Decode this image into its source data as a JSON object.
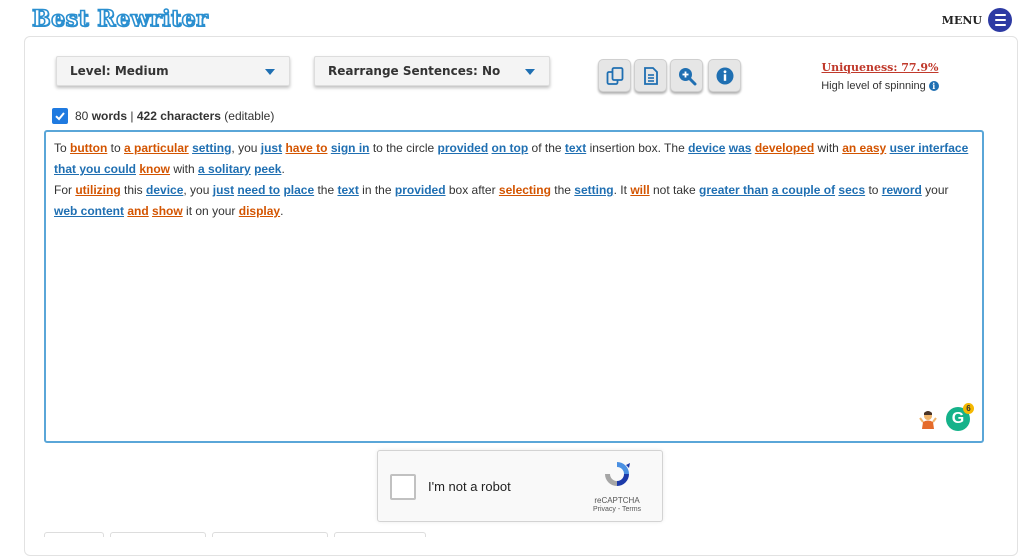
{
  "header": {
    "logo": "Best Rewriter",
    "menu_label": "MENU"
  },
  "controls": {
    "level": "Level: Medium",
    "rearrange": "Rearrange Sentences: No",
    "buttons": [
      "copy-icon",
      "document-icon",
      "zoom-in-icon",
      "info-icon"
    ]
  },
  "uniqueness": {
    "link": "Uniqueness: 77.9%",
    "subtext": "High level of spinning"
  },
  "counter": {
    "words_count": "80",
    "words_label": "words",
    "separator": "|",
    "chars": "422 characters",
    "note": "(editable)"
  },
  "editor": {
    "paragraphs": [
      [
        {
          "t": "To "
        },
        {
          "t": "button",
          "c": "o"
        },
        {
          "t": " to "
        },
        {
          "t": "a particular",
          "c": "o"
        },
        {
          "t": " "
        },
        {
          "t": "setting",
          "c": "b"
        },
        {
          "t": ", you "
        },
        {
          "t": "just",
          "c": "b"
        },
        {
          "t": " "
        },
        {
          "t": "have to",
          "c": "o"
        },
        {
          "t": " "
        },
        {
          "t": "sign in",
          "c": "b"
        },
        {
          "t": " to the circle "
        },
        {
          "t": "provided",
          "c": "b"
        },
        {
          "t": " "
        },
        {
          "t": "on top",
          "c": "b"
        },
        {
          "t": " of the "
        },
        {
          "t": "text",
          "c": "b"
        },
        {
          "t": " insertion box. The "
        },
        {
          "t": "device",
          "c": "b"
        },
        {
          "t": " "
        },
        {
          "t": "was",
          "c": "b"
        },
        {
          "t": " "
        },
        {
          "t": "developed",
          "c": "o"
        },
        {
          "t": " with "
        },
        {
          "t": "an easy",
          "c": "o"
        },
        {
          "t": " "
        },
        {
          "t": "user interface",
          "c": "b"
        },
        {
          "t": " "
        },
        {
          "t": "that you could",
          "c": "b"
        },
        {
          "t": " "
        },
        {
          "t": "know",
          "c": "o"
        },
        {
          "t": " with "
        },
        {
          "t": "a solitary",
          "c": "b"
        },
        {
          "t": " "
        },
        {
          "t": "peek",
          "c": "b"
        },
        {
          "t": "."
        }
      ],
      [
        {
          "t": "For "
        },
        {
          "t": "utilizing",
          "c": "o"
        },
        {
          "t": " this "
        },
        {
          "t": "device",
          "c": "b"
        },
        {
          "t": ", you "
        },
        {
          "t": "just",
          "c": "b"
        },
        {
          "t": " "
        },
        {
          "t": "need to",
          "c": "b"
        },
        {
          "t": " "
        },
        {
          "t": "place",
          "c": "b"
        },
        {
          "t": " the "
        },
        {
          "t": "text",
          "c": "b"
        },
        {
          "t": " in the "
        },
        {
          "t": "provided",
          "c": "b"
        },
        {
          "t": " box after "
        },
        {
          "t": "selecting",
          "c": "o"
        },
        {
          "t": " the "
        },
        {
          "t": "setting",
          "c": "b"
        },
        {
          "t": ". It "
        },
        {
          "t": "will",
          "c": "o"
        },
        {
          "t": " not take "
        },
        {
          "t": "greater than",
          "c": "b"
        },
        {
          "t": " "
        },
        {
          "t": "a couple of",
          "c": "b"
        },
        {
          "t": " "
        },
        {
          "t": "secs",
          "c": "b"
        },
        {
          "t": " to "
        },
        {
          "t": "reword",
          "c": "b"
        },
        {
          "t": " your "
        },
        {
          "t": "web content",
          "c": "b"
        },
        {
          "t": " "
        },
        {
          "t": "and",
          "c": "o"
        },
        {
          "t": " "
        },
        {
          "t": "show",
          "c": "o"
        },
        {
          "t": " it on your "
        },
        {
          "t": "display",
          "c": "o"
        },
        {
          "t": "."
        }
      ]
    ],
    "grammarly_count": "6"
  },
  "captcha": {
    "label": "I'm not a robot",
    "brand": "reCAPTCHA",
    "links": "Privacy - Terms"
  },
  "colors": {
    "synonym_blue": "#1f6fb2",
    "synonym_orange": "#d35400",
    "accent": "#2a8fd0"
  }
}
